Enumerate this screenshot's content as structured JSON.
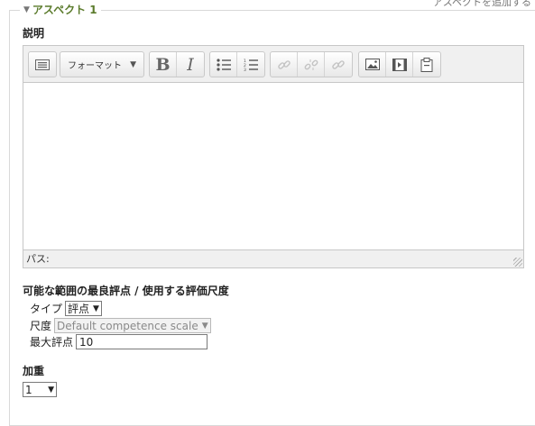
{
  "top_right_fragment": "アスペクトを追加する",
  "aspect": {
    "legend": "アスペクト 1",
    "description_label": "説明",
    "editor": {
      "format_label": "フォーマット",
      "bold": "B",
      "italic": "I",
      "path_label": "パス:"
    },
    "scale_section_title": "可能な範囲の最良評点 / 使用する評価尺度",
    "type_label": "タイプ",
    "type_value": "評点",
    "scale_label": "尺度",
    "scale_value": "Default competence scale",
    "max_grade_label": "最大評点",
    "max_grade_value": "10",
    "weight_label": "加重",
    "weight_value": "1"
  },
  "colors": {
    "legend": "#5b7b2c",
    "border": "#c7c7c7"
  },
  "icons": [
    "chevron-down-icon",
    "show-more-icon",
    "bullet-list-icon",
    "numbered-list-icon",
    "link-icon",
    "unlink-icon",
    "anchor-icon",
    "image-icon",
    "media-icon",
    "paste-icon",
    "resize-grip-icon"
  ]
}
